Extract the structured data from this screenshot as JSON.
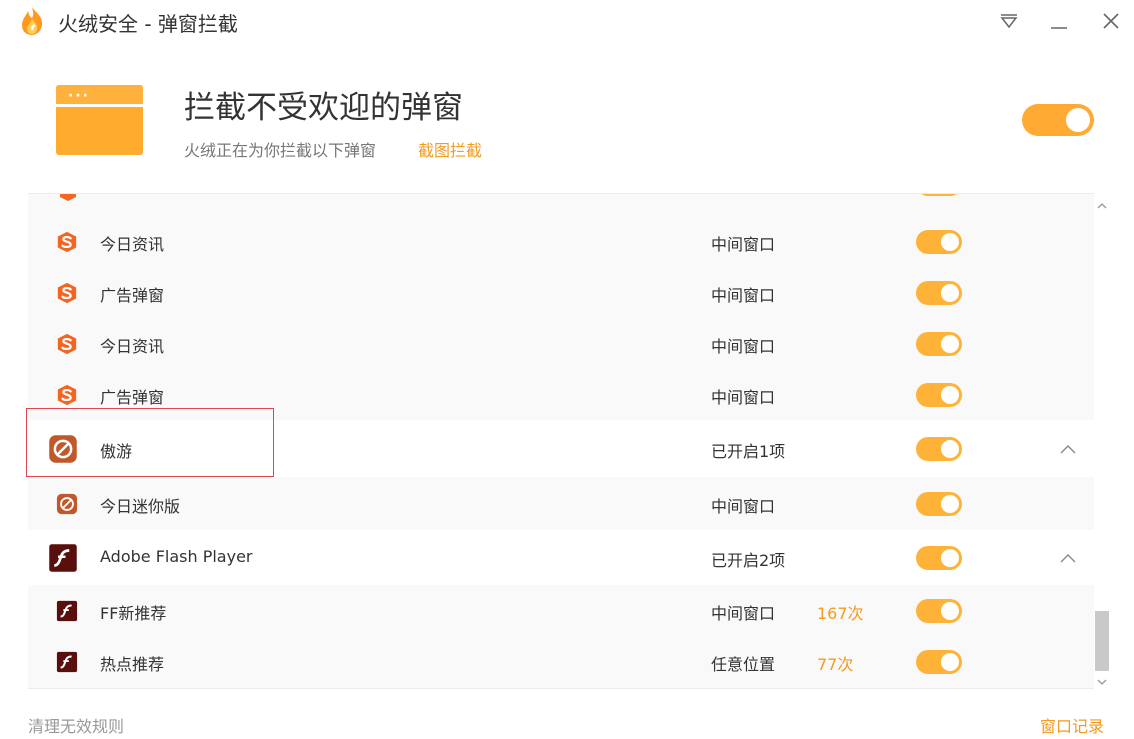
{
  "window": {
    "title": "火绒安全 - 弹窗拦截",
    "icons": {
      "logo": "huorong-flame-icon",
      "menu": "menu-triangle-icon",
      "minimize": "minimize-icon",
      "close": "close-icon"
    }
  },
  "header": {
    "title": "拦截不受欢迎的弹窗",
    "subtitle": "火绒正在为你拦截以下弹窗",
    "screenshot_link": "截图拦截",
    "master_toggle": "on",
    "icon": "popup-window-icon"
  },
  "list": {
    "rows": [
      {
        "name": "今日资讯",
        "status": "中间窗口",
        "count": "",
        "icon": "sogou-s-icon",
        "toggle": "on",
        "group": false
      },
      {
        "name": "广告弹窗",
        "status": "中间窗口",
        "count": "",
        "icon": "sogou-s-icon",
        "toggle": "on",
        "group": false
      },
      {
        "name": "今日资讯",
        "status": "中间窗口",
        "count": "",
        "icon": "sogou-s-icon",
        "toggle": "on",
        "group": false
      },
      {
        "name": "广告弹窗",
        "status": "中间窗口",
        "count": "",
        "icon": "sogou-s-icon",
        "toggle": "on",
        "group": false
      },
      {
        "name": "傲游",
        "status": "已开启1项",
        "count": "",
        "icon": "maxthon-icon",
        "toggle": "on",
        "group": true
      },
      {
        "name": "今日迷你版",
        "status": "中间窗口",
        "count": "",
        "icon": "maxthon-icon",
        "toggle": "on",
        "group": false
      },
      {
        "name": "Adobe Flash Player",
        "status": "已开启2项",
        "count": "",
        "icon": "flash-icon",
        "toggle": "on",
        "group": true
      },
      {
        "name": "FF新推荐",
        "status": "中间窗口",
        "count": "167次",
        "icon": "flash-icon",
        "toggle": "on",
        "group": false
      },
      {
        "name": "热点推荐",
        "status": "任意位置",
        "count": "77次",
        "icon": "flash-icon",
        "toggle": "on",
        "group": false
      }
    ]
  },
  "footer": {
    "clean_label": "清理无效规则",
    "history_label": "窗口记录"
  },
  "colors": {
    "accent": "#f29b1f",
    "toggle_on": "#ffb238",
    "highlight": "#e0464e",
    "sogou": "#f26522",
    "maxthon": "#c1582b",
    "flash": "#5a0f0f"
  }
}
